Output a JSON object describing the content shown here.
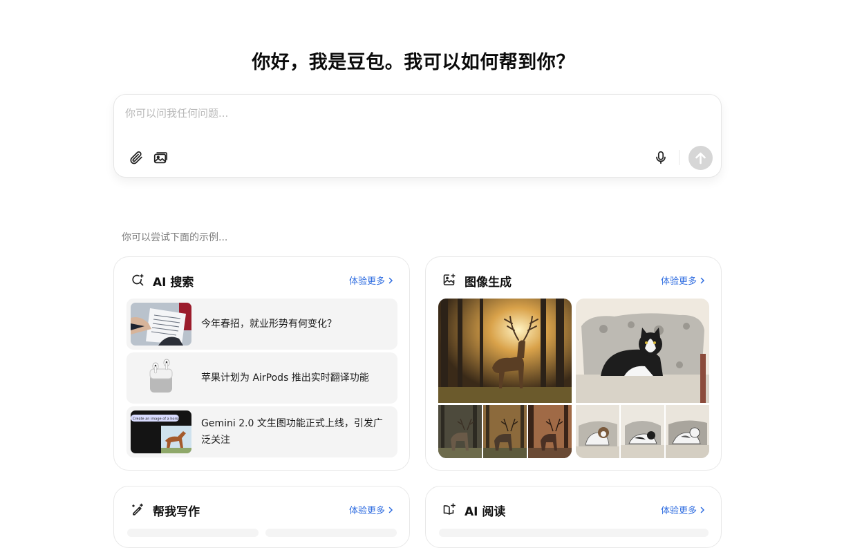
{
  "header": {
    "title": "你好，我是豆包。我可以如何帮到你？"
  },
  "chat": {
    "placeholder": "你可以问我任何问题..."
  },
  "icons": {
    "attach": "paperclip-icon",
    "image_upload": "image-upload-icon",
    "mic": "microphone-icon",
    "send": "arrow-up-icon"
  },
  "hint": "你可以尝试下面的示例...",
  "cards": {
    "search": {
      "title": "AI 搜索",
      "more": "体验更多",
      "items": [
        {
          "text": "今年春招，就业形势有何变化？",
          "thumb": "document-photo"
        },
        {
          "text": "苹果计划为 AirPods 推出实时翻译功能",
          "thumb": "airpods-photo"
        },
        {
          "text": "Gemini 2.0 文生图功能正式上线，引发广泛关注",
          "thumb": "horse-screenshot",
          "thumb_text": "Create an image of a horse"
        }
      ]
    },
    "image": {
      "title": "图像生成",
      "more": "体验更多",
      "images": [
        "deer-forest",
        "cat-on-sofa"
      ]
    },
    "writing": {
      "title": "帮我写作",
      "more": "体验更多"
    },
    "reading": {
      "title": "AI 阅读",
      "more": "体验更多"
    }
  },
  "colors": {
    "accent": "#2e6ce0",
    "send_disabled": "#d6d6d6",
    "item_bg": "#f4f4f4"
  }
}
